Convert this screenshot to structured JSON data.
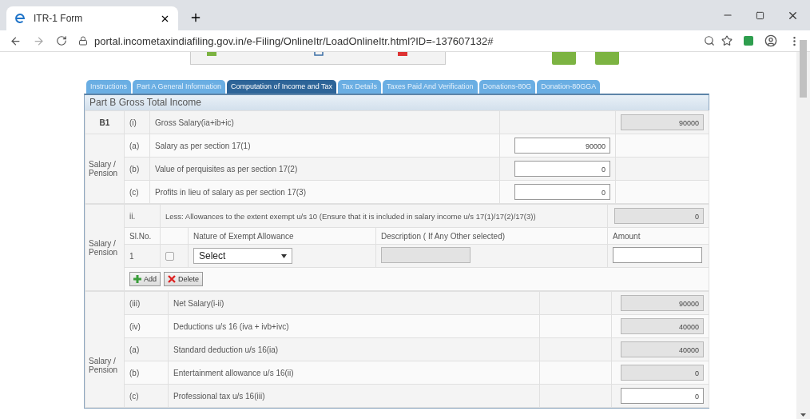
{
  "browser": {
    "tab_title": "ITR-1 Form",
    "address": "portal.incometaxindiafiling.gov.in/e-Filing/OnlineItr/LoadOnlineItr.html?ID=-137607132#"
  },
  "toolbar": {
    "buttons": [
      {
        "kind": "submit"
      },
      {
        "kind": "save"
      },
      {
        "kind": "exit"
      }
    ]
  },
  "tabs": [
    {
      "label": "Instructions",
      "selected": false
    },
    {
      "label": "Part A General Information",
      "selected": false
    },
    {
      "label": "Computation of Income and Tax",
      "selected": true
    },
    {
      "label": "Tax Details",
      "selected": false
    },
    {
      "label": "Taxes Paid And Verification",
      "selected": false
    },
    {
      "label": "Donations-80G",
      "selected": false
    },
    {
      "label": "Donation-80GGA",
      "selected": false
    }
  ],
  "section_title": "Part B Gross Total Income",
  "gross_salary": {
    "label": "B1",
    "index": "(i)",
    "description": "Gross Salary(ia+ib+ic)",
    "value": "90000",
    "readonly": true
  },
  "salary_block": {
    "group_label": "Salary / Pension",
    "rows": [
      {
        "index": "(a)",
        "description": "Salary as per section 17(1)",
        "value": "90000",
        "readonly": false
      },
      {
        "index": "(b)",
        "description": "Value of perquisites as per section 17(2)",
        "value": "0",
        "readonly": false
      },
      {
        "index": "(c)",
        "description": "Profits in lieu of salary as per section 17(3)",
        "value": "0",
        "readonly": false
      }
    ]
  },
  "allowances": {
    "group_label": "Salary / Pension",
    "index": "ii.",
    "description": "Less: Allowances to the extent exempt u/s 10 (Ensure that it is included in salary income u/s 17(1)/17(2)/17(3))",
    "total": "0",
    "total_readonly": true,
    "columns": [
      "Sl.No.",
      "Nature of Exempt Allowance",
      "Description ( If Any Other selected)",
      "Amount"
    ],
    "rows": [
      {
        "sl_no": "1",
        "checked": false,
        "nature": "Select"
      }
    ],
    "add_button": "Add",
    "delete_button": "Delete"
  },
  "deductions_block": {
    "group_label": "Salary / Pension",
    "rows": [
      {
        "index": "(iii)",
        "description": "Net Salary(i-ii)",
        "value": "90000",
        "readonly": true
      },
      {
        "index": "(iv)",
        "description": "Deductions u/s 16 (iva + ivb+ivc)",
        "value": "40000",
        "readonly": true
      },
      {
        "index": "(a)",
        "description": "Standard deduction u/s 16(ia)",
        "value": "40000",
        "readonly": true
      },
      {
        "index": "(b)",
        "description": "Entertainment allowance u/s 16(ii)",
        "value": "0",
        "readonly": true
      },
      {
        "index": "(c)",
        "description": "Professional tax u/s 16(iii)",
        "value": "0",
        "readonly": false
      }
    ]
  }
}
